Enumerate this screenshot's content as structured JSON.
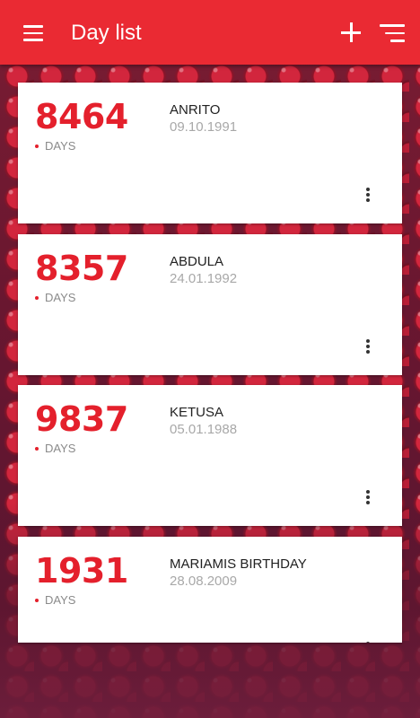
{
  "app_bar": {
    "title": "Day list",
    "icons": [
      "menu-icon",
      "add-icon",
      "sort-icon"
    ],
    "color": "#ea2a33"
  },
  "cards": [
    {
      "count": "8464",
      "unit": "DAYS",
      "name": "ANRITO",
      "date": "09.10.1991"
    },
    {
      "count": "8357",
      "unit": "DAYS",
      "name": "ABDULA",
      "date": "24.01.1992"
    },
    {
      "count": "9837",
      "unit": "DAYS",
      "name": "KETUSA",
      "date": "05.01.1988"
    },
    {
      "count": "1931",
      "unit": "DAYS",
      "name": "MARIAMIS BIRTHDAY",
      "date": "28.08.2009"
    }
  ],
  "colors": {
    "accent": "#e4202c",
    "card": "#ffffff"
  }
}
